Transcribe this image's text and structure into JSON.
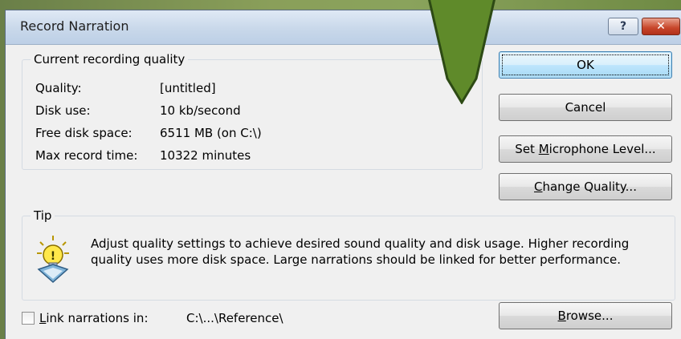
{
  "dialog": {
    "title": "Record Narration",
    "help_glyph": "?",
    "close_glyph": "✕"
  },
  "quality_group": {
    "label": "Current recording quality",
    "rows": [
      {
        "label": "Quality:",
        "value": "[untitled]"
      },
      {
        "label": "Disk use:",
        "value": "10 kb/second"
      },
      {
        "label": "Free disk space:",
        "value": "6511 MB (on C:\\)"
      },
      {
        "label": "Max record time:",
        "value": "10322 minutes"
      }
    ]
  },
  "buttons": {
    "ok": "OK",
    "cancel": "Cancel",
    "set_mic_prefix": "Set ",
    "set_mic_key": "M",
    "set_mic_rest": "icrophone Level...",
    "change_quality_key": "C",
    "change_quality_rest": "hange Quality...",
    "browse_key": "B",
    "browse_rest": "rowse..."
  },
  "tip_group": {
    "label": "Tip",
    "icon": "lightbulb-icon",
    "text": "Adjust quality settings to achieve desired sound quality and disk usage. Higher recording quality uses more disk space. Large narrations should be linked for better performance."
  },
  "link": {
    "checked": false,
    "label_key": "L",
    "label_rest": "ink narrations in:",
    "path": "C:\\...\\Reference\\"
  },
  "colors": {
    "arrow_fill": "#5f8a2a",
    "arrow_stroke": "#2d4a14",
    "close_red": "#c7452a"
  }
}
